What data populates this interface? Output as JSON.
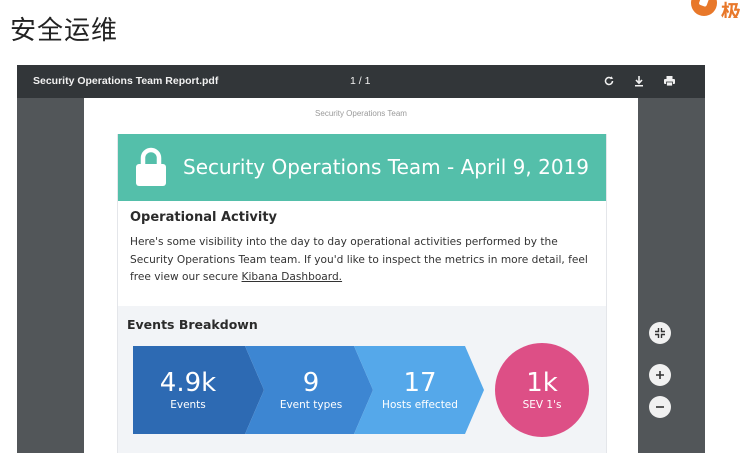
{
  "slide": {
    "title": "安全运维",
    "brand_text": "极"
  },
  "viewer": {
    "filename": "Security Operations Team Report.pdf",
    "page_indicator": "1 / 1",
    "toolbar_icons": [
      "rotate-icon",
      "download-icon",
      "print-icon"
    ],
    "float_icons": [
      "fit-page-icon",
      "zoom-in-icon",
      "zoom-out-icon"
    ]
  },
  "report": {
    "page_header": "Security Operations Team",
    "banner_title": "Security Operations Team - April 9, 2019",
    "section_title": "Operational Activity",
    "body_text": "Here's some visibility into the day to day operational activities performed by the Security Operations Team team. If you'd like to inspect the metrics in more detail, feel free view our secure ",
    "link_text": "Kibana Dashboard.",
    "events_title": "Events Breakdown",
    "metrics": [
      {
        "value": "4.9k",
        "label": "Events",
        "color": "#2d6ab3"
      },
      {
        "value": "9",
        "label": "Event types",
        "color": "#3d86d2"
      },
      {
        "value": "17",
        "label": "Hosts effected",
        "color": "#55a8ea"
      },
      {
        "value": "1k",
        "label": "SEV 1's",
        "color": "#dd4f86"
      }
    ]
  },
  "colors": {
    "banner": "#54bfaa",
    "toolbar": "#323639",
    "viewer_bg": "#525659"
  }
}
